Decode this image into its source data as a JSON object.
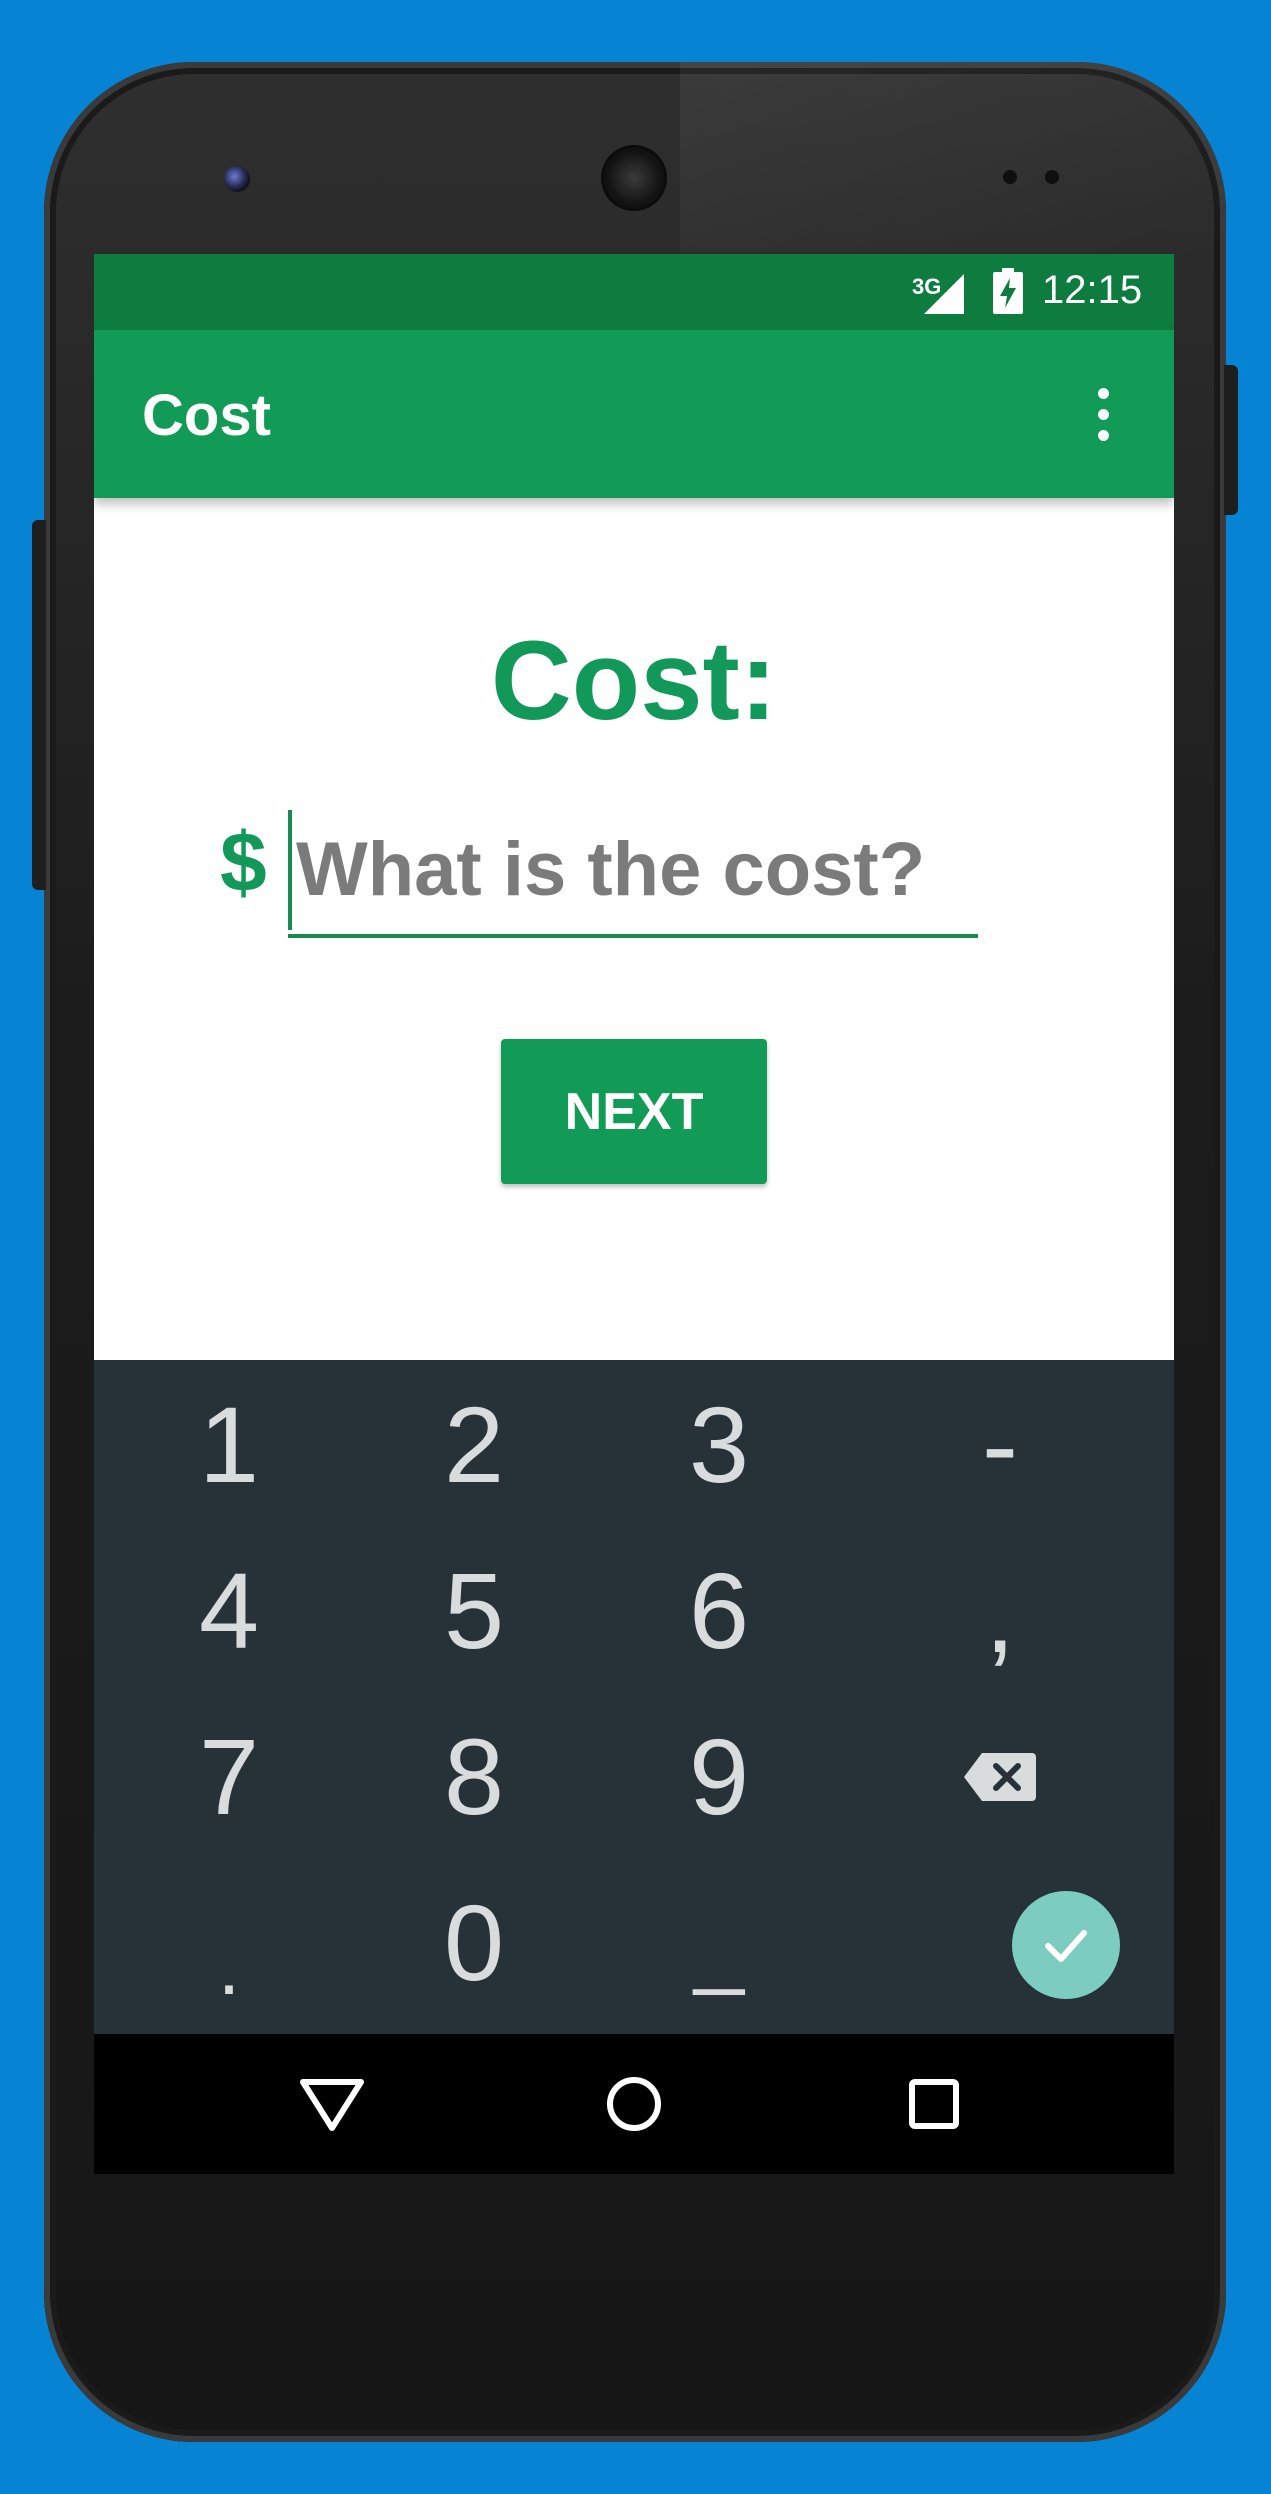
{
  "statusbar": {
    "network": "3G",
    "time": "12:15",
    "icons": [
      "signal-icon",
      "battery-charging-icon"
    ]
  },
  "toolbar": {
    "title": "Cost",
    "menu_icon": "more-vert-icon"
  },
  "form": {
    "heading": "Cost:",
    "currency_symbol": "$",
    "input_placeholder": "What is the cost?",
    "input_value": "",
    "next_label": "NEXT"
  },
  "keyboard": {
    "rows": [
      [
        "1",
        "2",
        "3",
        "-"
      ],
      [
        "4",
        "5",
        "6",
        ","
      ],
      [
        "7",
        "8",
        "9",
        "backspace"
      ],
      [
        ".",
        "0",
        "_",
        "done"
      ]
    ],
    "backspace_icon": "backspace-icon",
    "done_icon": "check-icon"
  },
  "navbar": {
    "items": [
      "back-icon",
      "home-icon",
      "recents-icon"
    ]
  },
  "colors": {
    "primary": "#129b56",
    "primary_dark": "#0e7c3f",
    "keyboard_bg": "#263238",
    "done_accent": "#7dccc0",
    "background": "#0783d3"
  }
}
